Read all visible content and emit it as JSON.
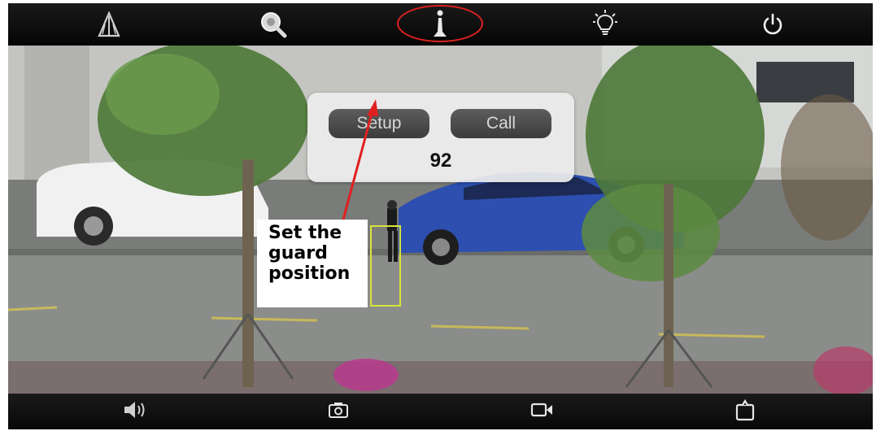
{
  "toolbar_top": {
    "items": [
      {
        "icon": "road-icon"
      },
      {
        "icon": "zoom-icon"
      },
      {
        "icon": "guard-position-icon"
      },
      {
        "icon": "light-bulb-icon"
      },
      {
        "icon": "power-icon"
      }
    ]
  },
  "popup": {
    "setup_label": "Setup",
    "call_label": "Call",
    "preset_value": "92"
  },
  "annotation": {
    "line1": "Set the",
    "line2": "guard",
    "line3": "position"
  },
  "toolbar_bottom": {
    "items": [
      {
        "icon": "speaker-icon"
      },
      {
        "icon": "camera-snapshot-icon"
      },
      {
        "icon": "video-record-icon"
      },
      {
        "icon": "share-icon"
      }
    ]
  },
  "colors": {
    "highlight": "#e02020",
    "guard_box": "#d8e43a",
    "toolbar_bg": "#0d0d0d"
  }
}
